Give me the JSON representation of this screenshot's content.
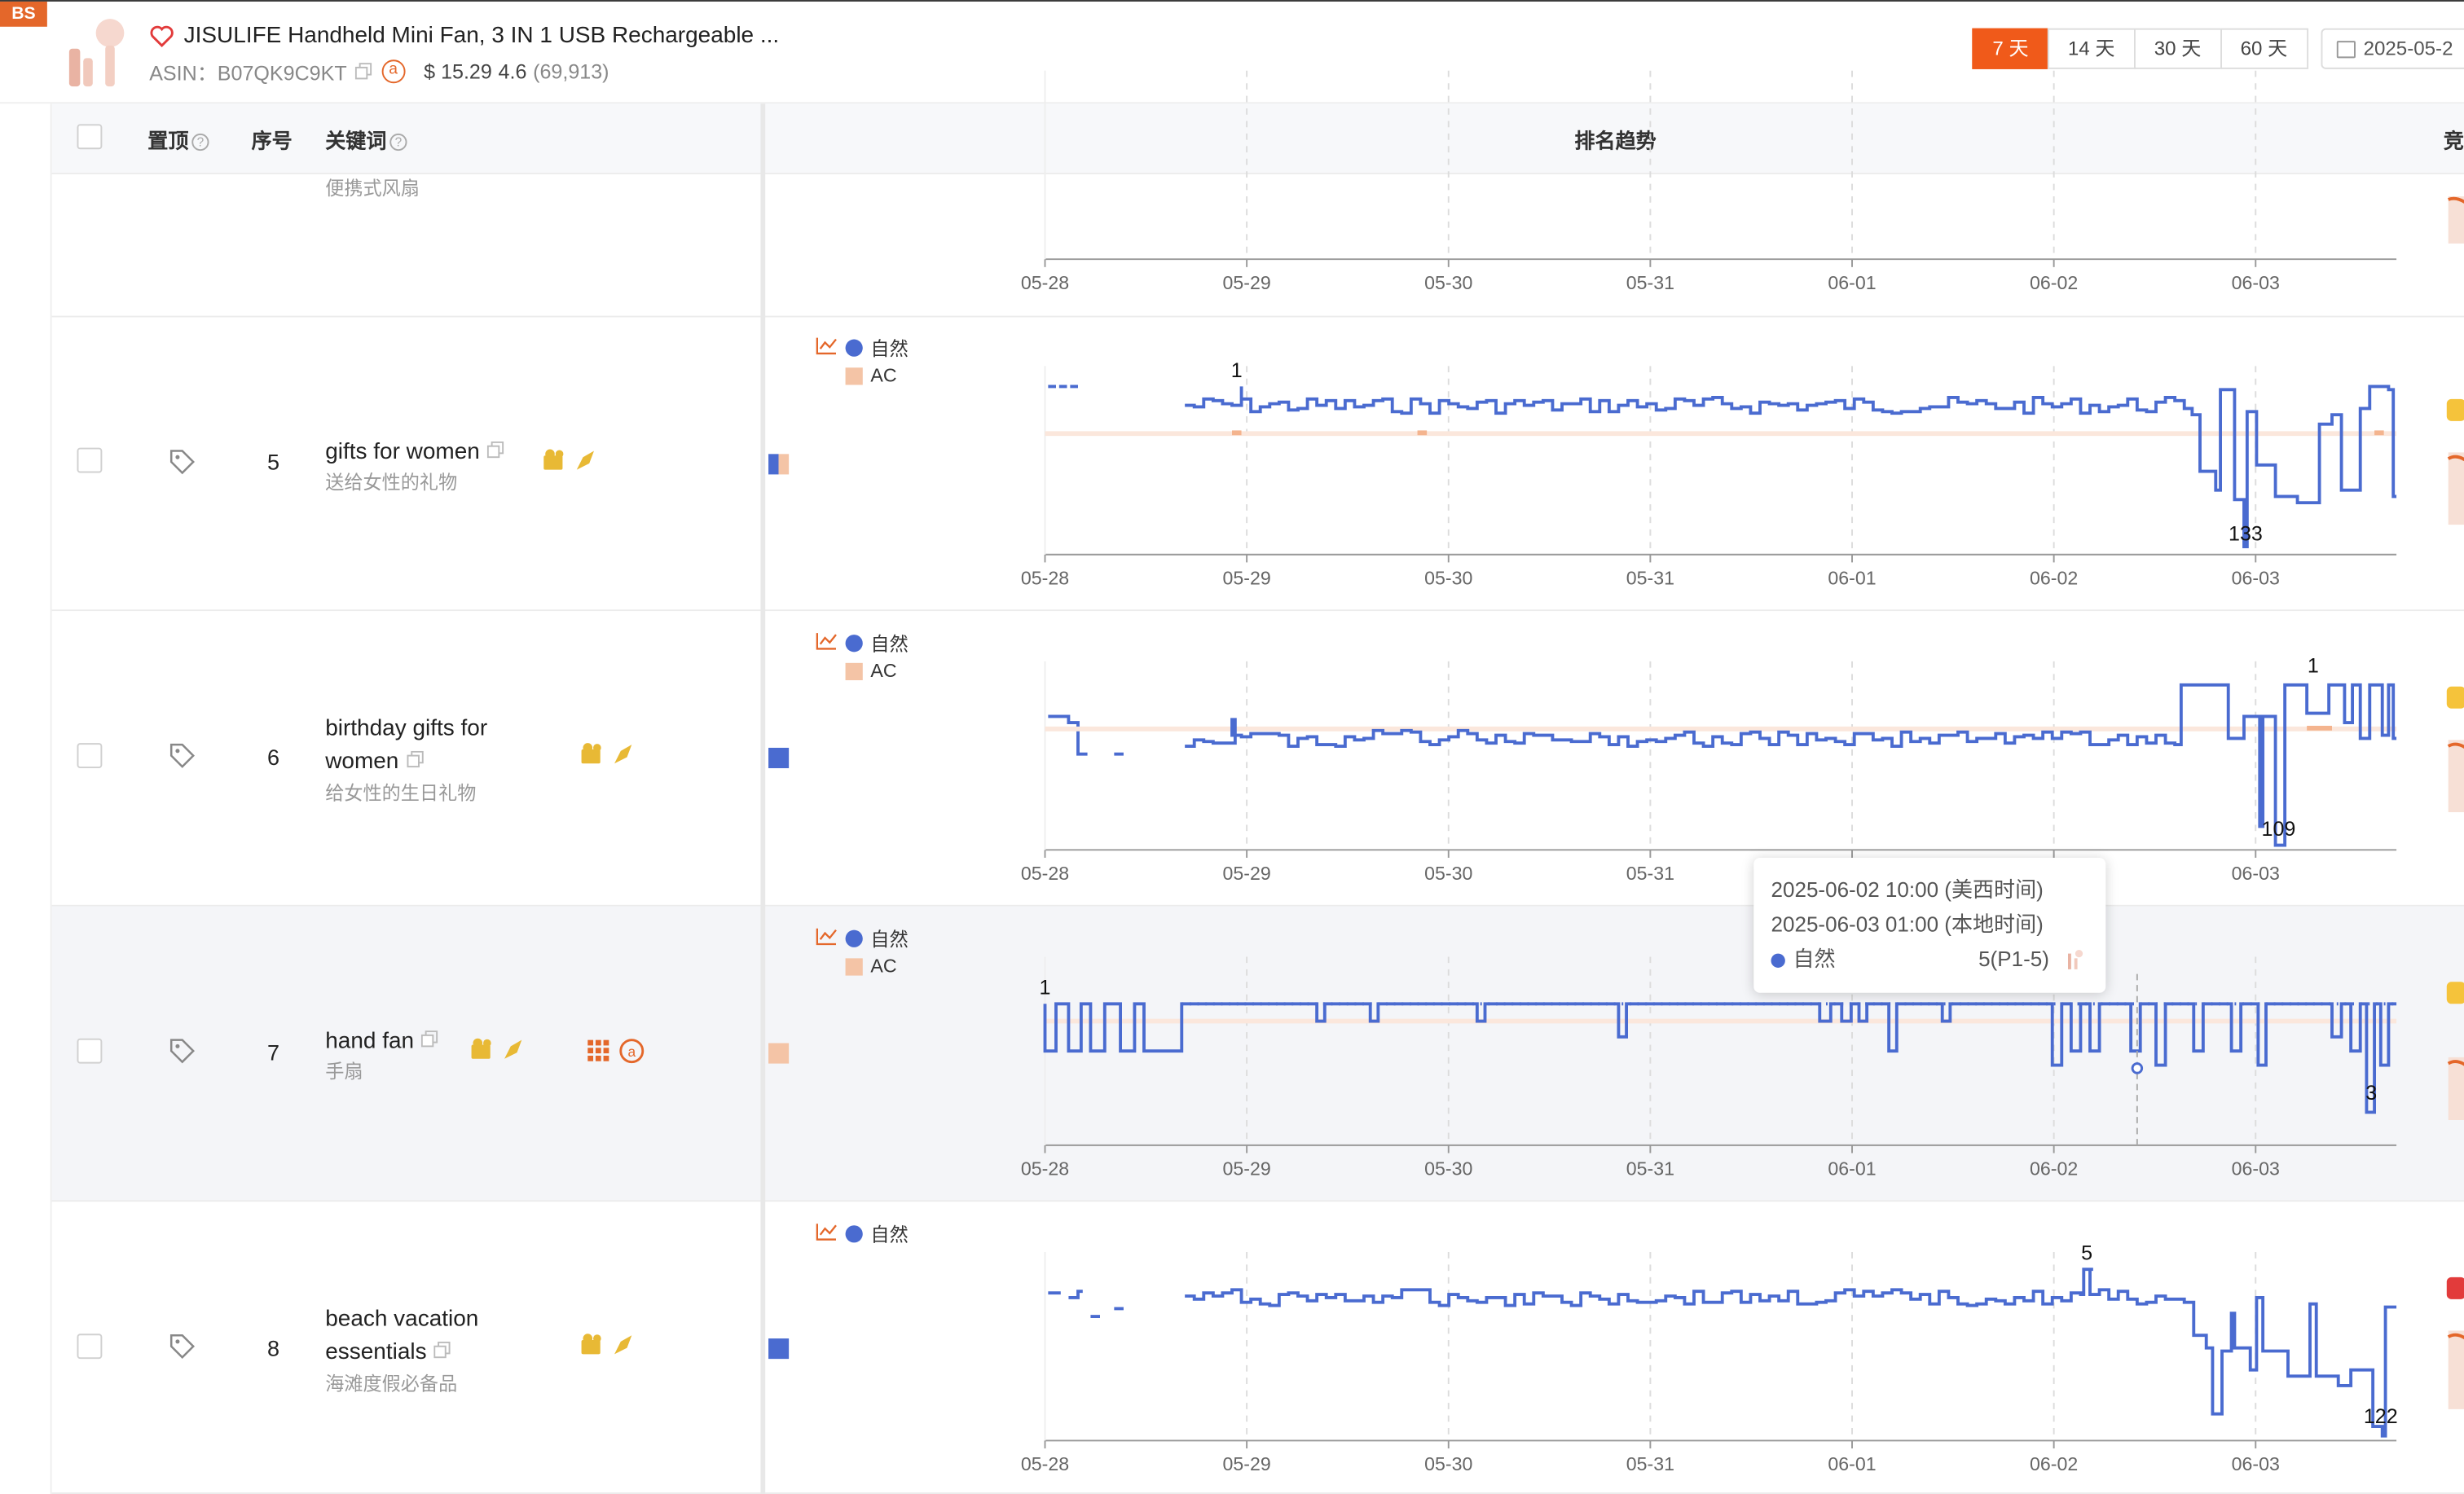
{
  "header": {
    "badge": "BS",
    "title": "JISULIFE Handheld Mini Fan, 3 IN 1 USB Rechargeable ...",
    "asin_label": "ASIN：B07QK9C9KT",
    "price": "$ 15.29",
    "rating": "4.6",
    "reviews": "(69,913)",
    "ranges": [
      "7 天",
      "14 天",
      "30 天",
      "60 天"
    ],
    "active_range": "7 天",
    "date_start": "2025-05-2"
  },
  "table": {
    "columns": {
      "pin": "置顶",
      "index": "序号",
      "keyword": "关键词",
      "trend": "排名趋势",
      "competitor": "竞"
    }
  },
  "x_ticks": [
    "05-28",
    "05-29",
    "05-30",
    "05-31",
    "06-01",
    "06-02",
    "06-03"
  ],
  "legend": {
    "natural": "自然",
    "ac": "AC"
  },
  "top_partial_row": {
    "keyword_cn": "便携式风扇"
  },
  "rows": [
    {
      "index": "5",
      "keyword": "gifts for women",
      "keyword_cn": "送给女性的礼物",
      "best_label": "1",
      "worst_label": "133",
      "has_ac": true
    },
    {
      "index": "6",
      "keyword": "birthday gifts for women",
      "keyword_cn": "给女性的生日礼物",
      "best_label": "1",
      "worst_label": "109",
      "has_ac": true
    },
    {
      "index": "7",
      "keyword": "hand fan",
      "keyword_cn": "手扇",
      "best_label": "1",
      "worst_label": "3",
      "has_ac": true
    },
    {
      "index": "8",
      "keyword": "beach vacation essentials",
      "keyword_cn": "海滩度假必备品",
      "best_label": "5",
      "worst_label": "122",
      "has_ac": false
    }
  ],
  "tooltip": {
    "us_time": "2025-06-02 10:00 (美西时间)",
    "local_time": "2025-06-03 01:00 (本地时间)",
    "series": "自然",
    "value": "5(P1-5)"
  },
  "colors": {
    "accent": "#f05a1a",
    "natural_series": "#4a6bd0",
    "ac_series": "#f4c4a6",
    "badge": "#e4672a"
  },
  "chart_data": [
    {
      "type": "line",
      "title": "gifts for women",
      "ylim": [
        1,
        133
      ],
      "x": [
        "05-28",
        "05-29",
        "05-30",
        "05-31",
        "06-01",
        "06-02",
        "06-03"
      ],
      "series": [
        {
          "name": "自然",
          "values": [
            12,
            1,
            10,
            9,
            12,
            8,
            133
          ]
        },
        {
          "name": "AC",
          "values": [
            null,
            30,
            30,
            null,
            null,
            null,
            30
          ]
        }
      ]
    },
    {
      "type": "line",
      "title": "birthday gifts for women",
      "ylim": [
        1,
        109
      ],
      "x": [
        "05-28",
        "05-29",
        "05-30",
        "05-31",
        "06-01",
        "06-02",
        "06-03"
      ],
      "series": [
        {
          "name": "自然",
          "values": [
            30,
            25,
            32,
            30,
            32,
            28,
            109
          ]
        }
      ]
    },
    {
      "type": "line",
      "title": "hand fan",
      "ylim": [
        1,
        3
      ],
      "x": [
        "05-28",
        "05-29",
        "05-30",
        "05-31",
        "06-01",
        "06-02",
        "06-03"
      ],
      "series": [
        {
          "name": "自然",
          "values": [
            1,
            1,
            1,
            1,
            1,
            1,
            3
          ]
        }
      ]
    },
    {
      "type": "line",
      "title": "beach vacation essentials",
      "ylim": [
        5,
        122
      ],
      "x": [
        "05-28",
        "05-29",
        "05-30",
        "05-31",
        "06-01",
        "06-02",
        "06-03"
      ],
      "series": [
        {
          "name": "自然",
          "values": [
            25,
            30,
            28,
            30,
            28,
            5,
            122
          ]
        }
      ]
    }
  ]
}
